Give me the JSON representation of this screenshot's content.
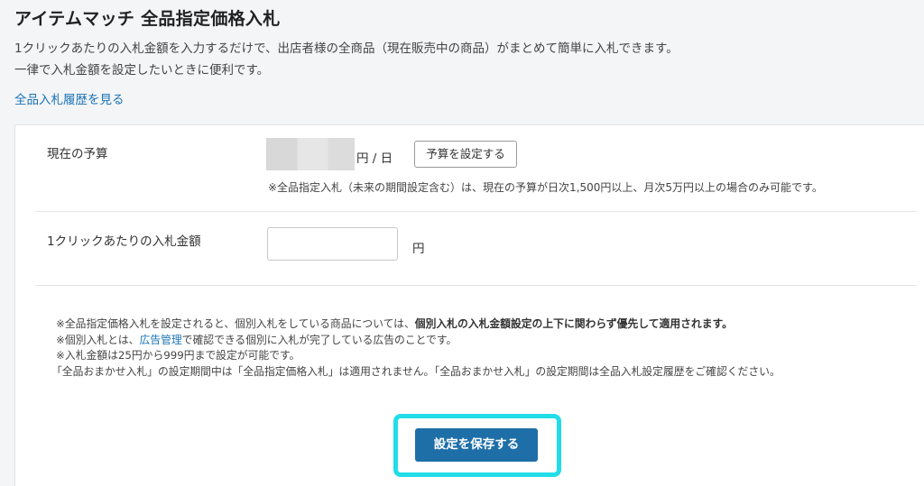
{
  "page": {
    "title": "アイテムマッチ 全品指定価格入札",
    "description_line1": "1クリックあたりの入札金額を入力するだけで、出店者様の全商品（現在販売中の商品）がまとめて簡単に入札できます。",
    "description_line2": "一律で入札金額を設定したいときに便利です。",
    "history_link": "全品入札履歴を見る"
  },
  "budget": {
    "label": "現在の予算",
    "value_masked": "",
    "unit": "円 / 日",
    "set_button": "予算を設定する",
    "note": "※全品指定入札（未来の期間設定含む）は、現在の予算が日次1,500円以上、月次5万円以上の場合のみ可能です。"
  },
  "bid": {
    "label": "1クリックあたりの入札金額",
    "value": "",
    "placeholder": "",
    "unit": "円"
  },
  "notes": {
    "line1_prefix": "※全品指定価格入札を設定されると、個別入札をしている商品については、",
    "line1_bold": "個別入札の入札金額設定の上下に関わらず優先して適用されます。",
    "line2_prefix": "※個別入札とは、",
    "line2_link": "広告管理",
    "line2_suffix": "で確認できる個別に入札が完了している広告のことです。",
    "line3": "※入札金額は25円から999円まで設定が可能です。",
    "line4": "「全品おまかせ入札」の設定期間中は「全品指定価格入札」は適用されません。「全品おまかせ入札」の設定期間は全品入札設定履歴をご確認ください。"
  },
  "save_button": "設定を保存する",
  "colors": {
    "accent": "#1e6fa8",
    "link": "#1a73b5",
    "highlight": "#22dde8",
    "background": "#f4f5f7"
  }
}
